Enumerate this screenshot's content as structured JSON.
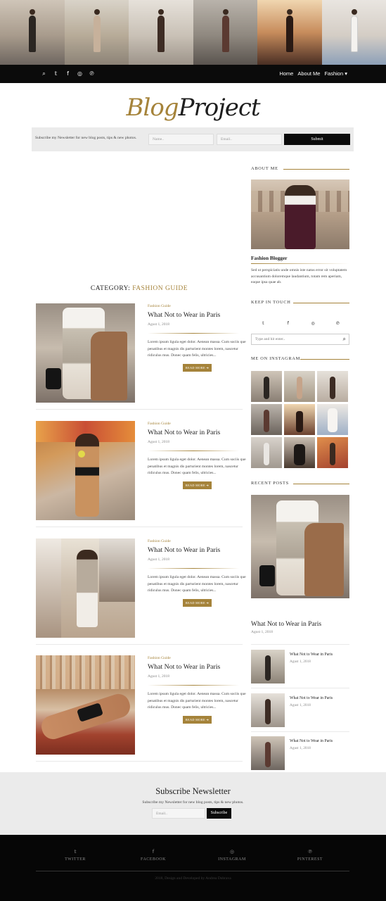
{
  "header": {
    "photo_strip": [
      "photo-street-1",
      "photo-street-2",
      "photo-cathedral",
      "photo-street-3",
      "photo-sunset",
      "photo-white-shirt"
    ],
    "social_icons": [
      "search-icon",
      "twitter-icon",
      "facebook-icon",
      "instagram-icon",
      "pinterest-icon"
    ],
    "social_glyphs": [
      "⌕",
      "𝕥",
      "f",
      "◎",
      "℗"
    ],
    "nav": {
      "home": "Home",
      "about": "About Me",
      "fashion": "Fashion ▾"
    }
  },
  "logo": {
    "part1": "Blog",
    "part2": "Project"
  },
  "newsletter_bar": {
    "text": "Subscribe my Newsletter for new blog posts, tips & new photos.",
    "name_placeholder": "Name..",
    "email_placeholder": "Email..",
    "submit": "Submit"
  },
  "category": {
    "label": "CATEGORY: ",
    "value": "FASHION GUIDE"
  },
  "posts": [
    {
      "category": "Fashion Guide",
      "title": "What Not to Wear in Paris",
      "date": "Agust 1, 2018",
      "excerpt": "Lorem ipsum ligula eget dolor. Aenean massa. Cum sociis que penatibus et magnis dis parturient montes lorem, nascetur ridiculus mus. Donec quam felis, ultricies...",
      "read_more": "READ MORE ➜"
    },
    {
      "category": "Fashion Guide",
      "title": "What Not to Wear in Paris",
      "date": "Agust 1, 2018",
      "excerpt": "Lorem ipsum ligula eget dolor. Aenean massa. Cum sociis que penatibus et magnis dis parturient montes lorem, nascetur ridiculus mus. Donec quam felis, ultricies...",
      "read_more": "READ MORE ➜"
    },
    {
      "category": "Fashion Guide",
      "title": "What Not to Wear in Paris",
      "date": "Agust 1, 2018",
      "excerpt": "Lorem ipsum ligula eget dolor. Aenean massa. Cum sociis que penatibus et magnis dis parturient montes lorem, nascetur ridiculus mus. Donec quam felis, ultricies...",
      "read_more": "READ MORE ➜"
    },
    {
      "category": "Fashion Guide",
      "title": "What Not to Wear in Paris",
      "date": "Agust 1, 2018",
      "excerpt": "Lorem ipsum ligula eget dolor. Aenean massa. Cum sociis que penatibus et magnis dis parturient montes lorem, nascetur ridiculus mus. Donec quam felis, ultricies...",
      "read_more": "READ MORE ➜"
    }
  ],
  "sidebar": {
    "about": {
      "heading": "ABOUT ME",
      "name": "Fashion Blogger",
      "text": "Sed ut perspiciatis unde omnis iste natus error sit voluptatem accusantium doloremque laudantium, totam rem aperiam, eaque ipsa quae ab."
    },
    "touch": {
      "heading": "KEEP IN TOUCH",
      "icons": [
        "twitter-icon",
        "facebook-icon",
        "instagram-icon",
        "pinterest-icon"
      ],
      "glyphs": [
        "𝕥",
        "f",
        "◎",
        "℗"
      ],
      "search_placeholder": "Type and hit enter..",
      "search_glyph": "⌕"
    },
    "instagram": {
      "heading": "ME ON INSTAGRAM"
    },
    "recent": {
      "heading": "RECENT POSTS",
      "featured": {
        "title": "What Not to Wear in Paris",
        "date": "Agust 1, 2018"
      },
      "items": [
        {
          "title": "What Not to Wear in Paris",
          "date": "Agust 1, 2018"
        },
        {
          "title": "What Not to Wear in Paris",
          "date": "Agust 1, 2018"
        },
        {
          "title": "What Not to Wear in Paris",
          "date": "Agust 1, 2018"
        }
      ]
    }
  },
  "subscribe": {
    "title": "Subscribe Newsletter",
    "subtitle": "Subscribe my Newsletter for new blog posts, tips & new photos.",
    "email_placeholder": "Email..",
    "button": "Subscribe"
  },
  "footer": {
    "links": [
      {
        "icon": "twitter-icon",
        "glyph": "𝕥",
        "label": "TWITTER"
      },
      {
        "icon": "facebook-icon",
        "glyph": "f",
        "label": "FACEBOOK"
      },
      {
        "icon": "instagram-icon",
        "glyph": "◎",
        "label": "INSTAGRAM"
      },
      {
        "icon": "pinterest-icon",
        "glyph": "℗",
        "label": "PINTEREST"
      }
    ],
    "copyright": "2018, Design and Developed by Andrea Dobrava"
  },
  "colors": {
    "accent": "#a5833a",
    "dark": "#0b0b0b",
    "light_gray": "#ebebeb"
  }
}
